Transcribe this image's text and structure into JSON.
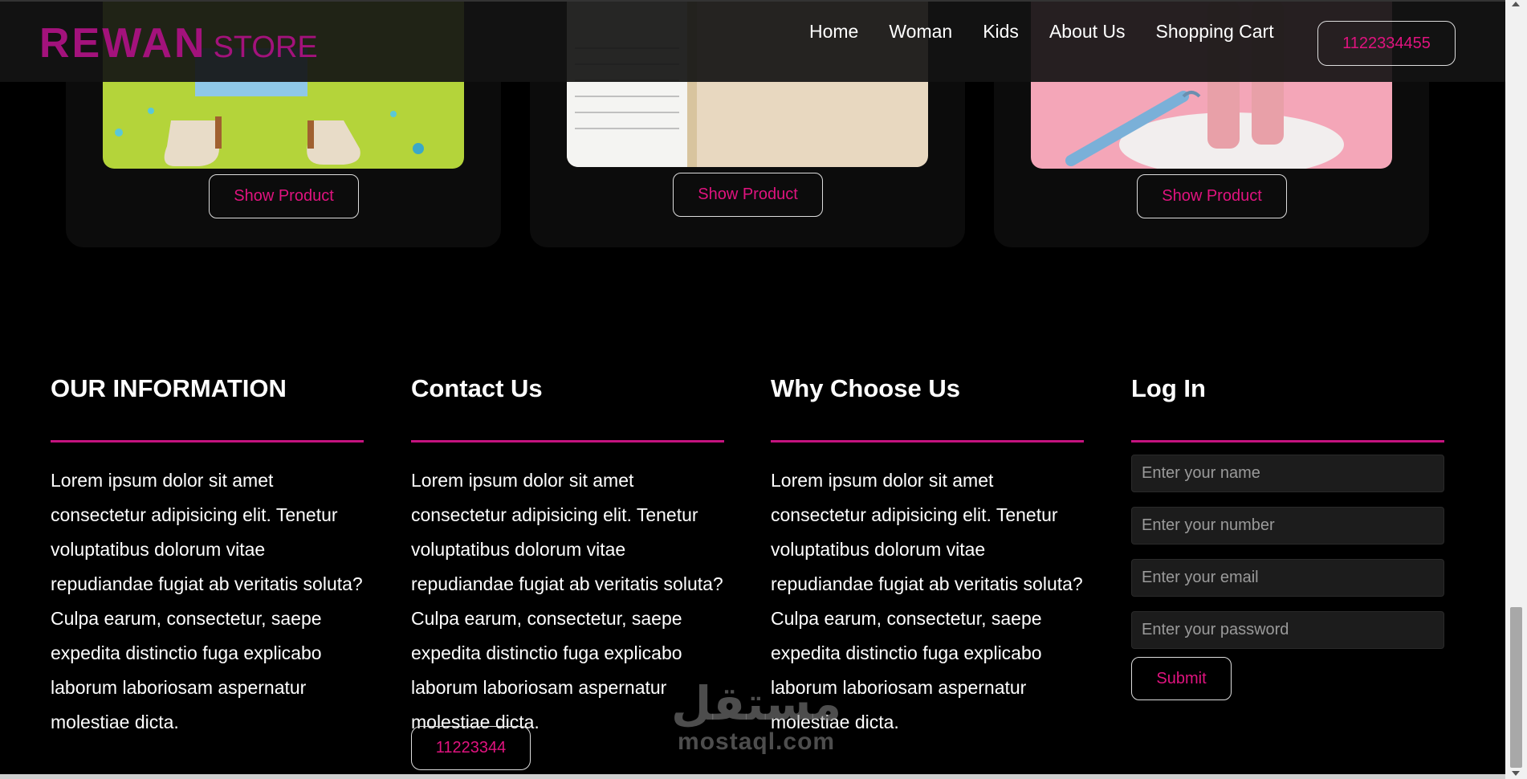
{
  "header": {
    "brand": "REWAN",
    "brand_suffix": "STORE",
    "nav": [
      "Home",
      "Woman",
      "Kids",
      "About Us",
      "Shopping Cart"
    ],
    "phone": "1122334455"
  },
  "products": [
    {
      "button": "Show Product"
    },
    {
      "button": "Show Product"
    },
    {
      "button": "Show Product"
    }
  ],
  "footer": {
    "info": {
      "title": "OUR INFORMATION",
      "text": "Lorem ipsum dolor sit amet consectetur adipisicing elit. Tenetur voluptatibus dolorum vitae repudiandae fugiat ab veritatis soluta? Culpa earum, consectetur, saepe expedita distinctio fuga explicabo laborum laboriosam aspernatur molestiae dicta."
    },
    "contact": {
      "title": "Contact Us",
      "text": "Lorem ipsum dolor sit amet consectetur adipisicing elit. Tenetur voluptatibus dolorum vitae repudiandae fugiat ab veritatis soluta? Culpa earum, consectetur, saepe expedita distinctio fuga explicabo laborum laboriosam aspernatur molestiae dicta.",
      "phone": "11223344"
    },
    "why": {
      "title": "Why Choose Us",
      "text": "Lorem ipsum dolor sit amet consectetur adipisicing elit. Tenetur voluptatibus dolorum vitae repudiandae fugiat ab veritatis soluta? Culpa earum, consectetur, saepe expedita distinctio fuga explicabo laborum laboriosam aspernatur molestiae dicta."
    },
    "login": {
      "title": "Log In",
      "name_placeholder": "Enter your name",
      "number_placeholder": "Enter your number",
      "email_placeholder": "Enter your email",
      "password_placeholder": "Enter your password",
      "submit": "Submit"
    }
  },
  "watermark": {
    "arabic": "مستقل",
    "latin": "mostaql.com"
  },
  "colors": {
    "accent": "#e0137f",
    "brand": "#a3127c",
    "rule": "#c4137f",
    "background": "#000000"
  }
}
